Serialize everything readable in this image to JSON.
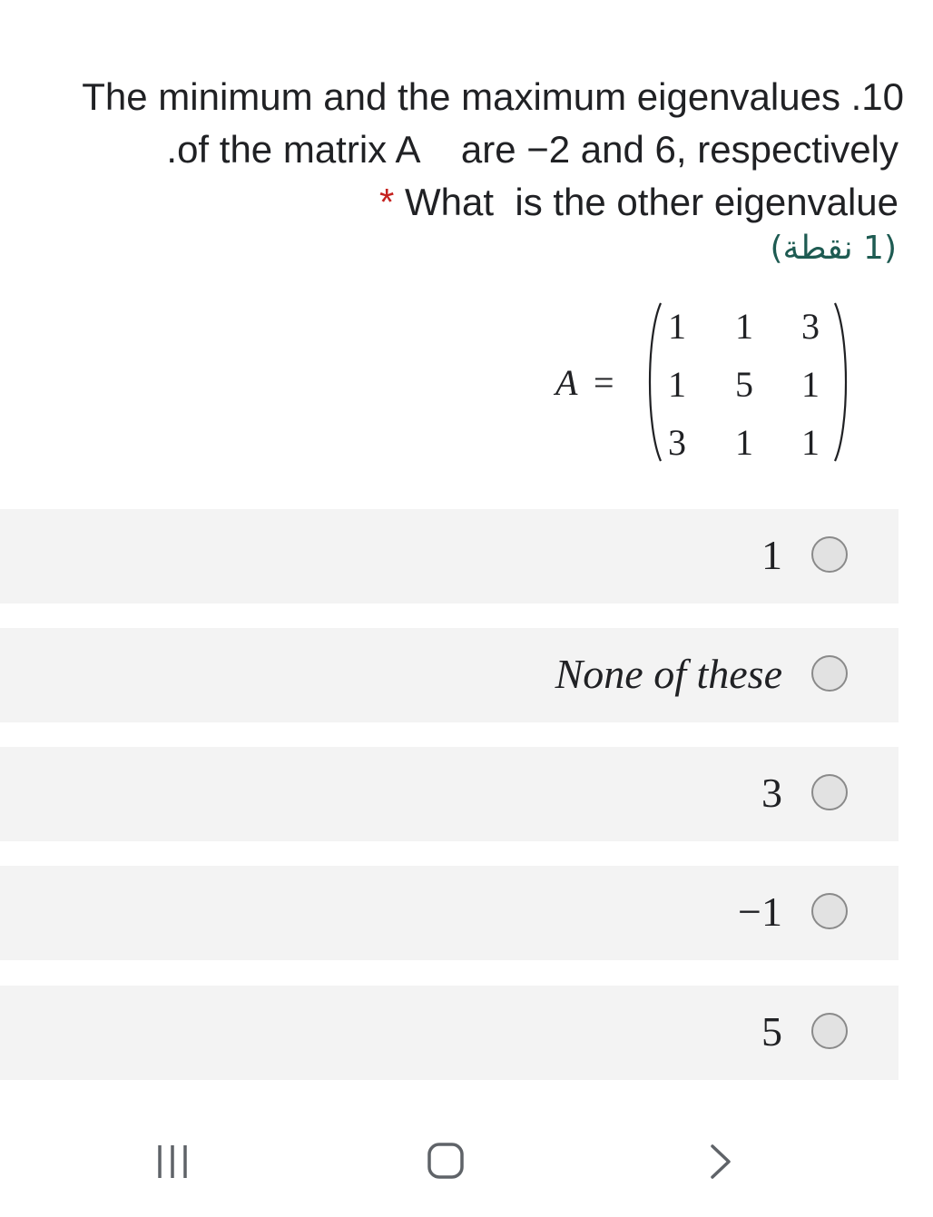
{
  "question": {
    "lines": [
      "The minimum and the maximum eigenvalues .10",
      ".of the matrix A    are −2 and 6, respectively",
      "What  is the other eigenvalue"
    ],
    "required_marker": "*",
    "points": "(1 نقطة)"
  },
  "matrix": {
    "name": "A",
    "equals": "=",
    "rows": [
      [
        "1",
        "1",
        "3"
      ],
      [
        "1",
        "5",
        "1"
      ],
      [
        "3",
        "1",
        "1"
      ]
    ]
  },
  "options": [
    {
      "label": "1",
      "italic": false
    },
    {
      "label": "None of these",
      "italic": true
    },
    {
      "label": "3",
      "italic": false
    },
    {
      "label": "−1",
      "italic": false
    },
    {
      "label": "5",
      "italic": false
    }
  ],
  "navbar": {
    "icons": [
      "recent-apps-icon",
      "home-icon",
      "back-icon"
    ]
  }
}
